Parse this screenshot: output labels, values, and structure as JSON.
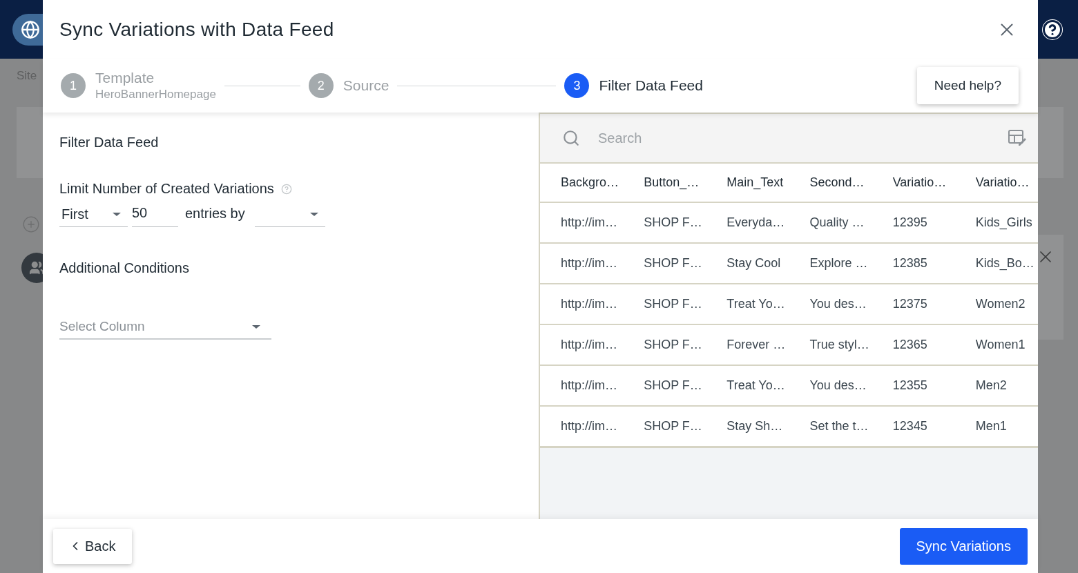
{
  "backdrop": {
    "site_label": "Site"
  },
  "dialog": {
    "title": "Sync Variations with Data Feed",
    "steps": [
      {
        "number": "1",
        "label": "Template",
        "sublabel": "HeroBannerHomepage",
        "selected": false
      },
      {
        "number": "2",
        "label": "Source",
        "selected": false
      },
      {
        "number": "3",
        "label": "Filter Data Feed",
        "selected": true
      }
    ],
    "help_button": "Need help?",
    "filter": {
      "heading": "Filter Data Feed",
      "limit_label": "Limit Number of Created Variations",
      "limit_mode": "First",
      "limit_count": "50",
      "entries_by_label": "entries by",
      "additional_heading": "Additional Conditions",
      "select_column_placeholder": "Select Column"
    },
    "table": {
      "search_placeholder": "Search",
      "columns": [
        "Backgro…",
        "Button_…",
        "Main_Text",
        "Second…",
        "Variatio…",
        "Variatio…"
      ],
      "rows": [
        [
          "http://im…",
          "SHOP F…",
          "Everyda…",
          "Quality …",
          "12395",
          "Kids_Girls"
        ],
        [
          "http://im…",
          "SHOP F…",
          "Stay Cool",
          "Explore …",
          "12385",
          "Kids_Bo…"
        ],
        [
          "http://im…",
          "SHOP F…",
          "Treat Yo…",
          "You des…",
          "12375",
          "Women2"
        ],
        [
          "http://im…",
          "SHOP F…",
          "Forever …",
          "True styl…",
          "12365",
          "Women1"
        ],
        [
          "http://im…",
          "SHOP F…",
          "Treat Yo…",
          "You des…",
          "12355",
          "Men2"
        ],
        [
          "http://im…",
          "SHOP F…",
          "Stay Sh…",
          "Set the t…",
          "12345",
          "Men1"
        ]
      ]
    },
    "back_button": "Back",
    "sync_button": "Sync Variations"
  }
}
